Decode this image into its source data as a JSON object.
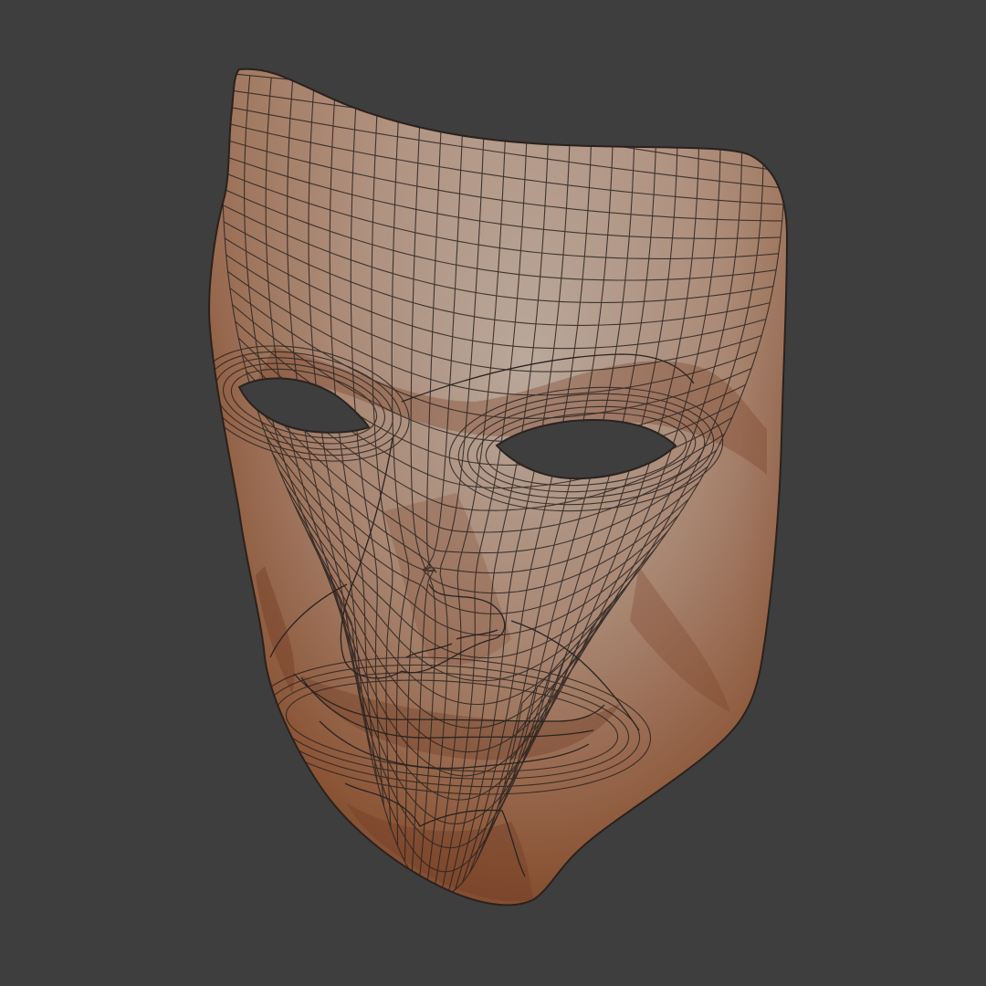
{
  "scene": {
    "background_color": "#3e3e3e",
    "subject": "mask-3d-model",
    "shading": "wireframe-on-shaded",
    "colors": {
      "skin_highlight": "#b7a497",
      "skin_mid": "#a5836f",
      "skin_shadow": "#8a5338",
      "skin_deep_shadow": "#6e3a22",
      "wire": "#2a2320",
      "eye_hole": "#3e3e3e"
    }
  }
}
